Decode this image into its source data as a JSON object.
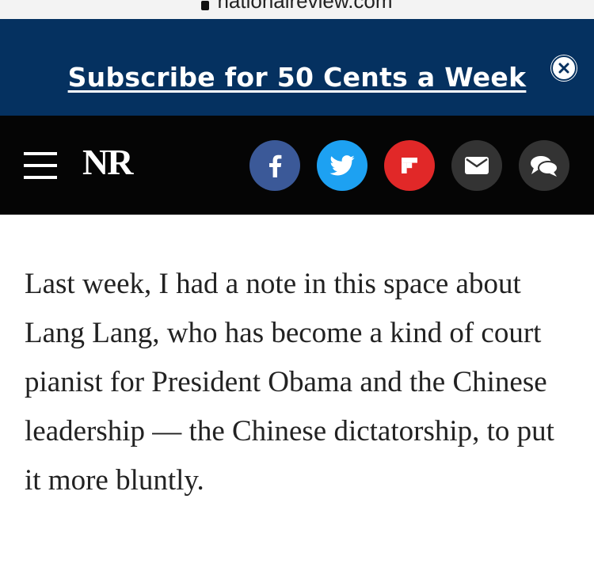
{
  "browser": {
    "url": "nationalreview.com"
  },
  "banner": {
    "subscribe_text": "Subscribe for 50 Cents a Week",
    "background": "#053160",
    "close_icon": "close-circle-icon"
  },
  "nav": {
    "menu_icon": "hamburger-menu-icon",
    "logo_text": "NR",
    "share": [
      {
        "name": "facebook",
        "icon": "facebook-icon",
        "color": "#3b5998"
      },
      {
        "name": "twitter",
        "icon": "twitter-icon",
        "color": "#1da1f2"
      },
      {
        "name": "flipboard",
        "icon": "flipboard-icon",
        "color": "#e12828"
      },
      {
        "name": "email",
        "icon": "email-icon",
        "color": "#333333"
      },
      {
        "name": "comments",
        "icon": "comments-icon",
        "color": "#333333"
      }
    ]
  },
  "article": {
    "paragraph": "Last week, I had a note in this space about Lang Lang, who has become a kind of court pianist for President Obama and the Chinese leadership — the Chinese dictatorship, to put it more bluntly."
  }
}
